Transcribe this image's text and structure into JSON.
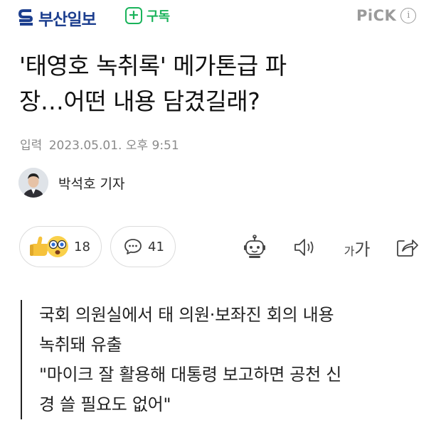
{
  "header": {
    "brand": "부산일보",
    "subscribe_label": "구독",
    "pick_label": "PiCK",
    "info_glyph": "i"
  },
  "article": {
    "title_line1": "'태영호 녹취록' 메가톤급 파",
    "title_line2": "장…어떤 내용 담겼길래?",
    "date_label": "입력",
    "date_value": "2023.05.01. 오후 9:51",
    "author": "박석호 기자"
  },
  "actions": {
    "reaction_count": "18",
    "comment_count": "41",
    "font_small": "가",
    "font_big": "가"
  },
  "summary": {
    "line1": "국회 의원실에서 태 의원·보좌진 회의 내용",
    "line2": "녹취돼 유출",
    "line3": "\"마이크 잘 활용해 대통령 보고하면 공천 신",
    "line4": "경 쓸 필요도 없어\""
  },
  "colors": {
    "brand_blue": "#1d3f8f",
    "subscribe_green": "#19b35a",
    "muted_gray": "#8a8a8a"
  },
  "icons": [
    "busan-ilbo-logo-icon",
    "plus-icon",
    "info-icon",
    "thumbs-up-emoji-icon",
    "surprised-emoji-icon",
    "comment-icon",
    "robot-summary-icon",
    "speaker-icon",
    "font-size-icon",
    "share-icon"
  ]
}
